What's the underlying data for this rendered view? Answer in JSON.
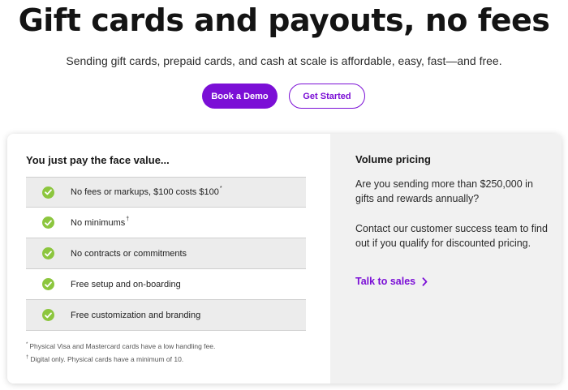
{
  "hero": {
    "title": "Gift cards and payouts, no fees",
    "subtitle": "Sending gift cards, prepaid cards, and cash at scale is affordable, easy, fast—and free.",
    "primary_button": "Book a Demo",
    "secondary_button": "Get Started"
  },
  "colors": {
    "brand_purple": "#7b0fd6",
    "check_green": "#8cc63e",
    "panel_gray": "#f1f1f1"
  },
  "pricing": {
    "heading": "You just pay the face value...",
    "features": [
      {
        "label": "No fees or markups, $100 costs $100",
        "mark": "*",
        "icon": "check-icon"
      },
      {
        "label": "No minimums",
        "mark": "†",
        "icon": "check-icon"
      },
      {
        "label": "No contracts or commitments",
        "mark": "",
        "icon": "check-icon"
      },
      {
        "label": "Free setup and on-boarding",
        "mark": "",
        "icon": "check-icon"
      },
      {
        "label": "Free customization and branding",
        "mark": "",
        "icon": "check-icon"
      }
    ],
    "footnotes": [
      {
        "mark": "*",
        "text": "Physical Visa and Mastercard cards have a low handling fee."
      },
      {
        "mark": "†",
        "text": "Digital only. Physical cards have a minimum of 10."
      }
    ]
  },
  "volume": {
    "title": "Volume pricing",
    "paragraph1": "Are you sending more than $250,000 in gifts and rewards annually?",
    "paragraph2": "Contact our customer success team to find out if you qualify for discounted pricing.",
    "link": "Talk to sales",
    "link_icon": "chevron-right-icon"
  }
}
